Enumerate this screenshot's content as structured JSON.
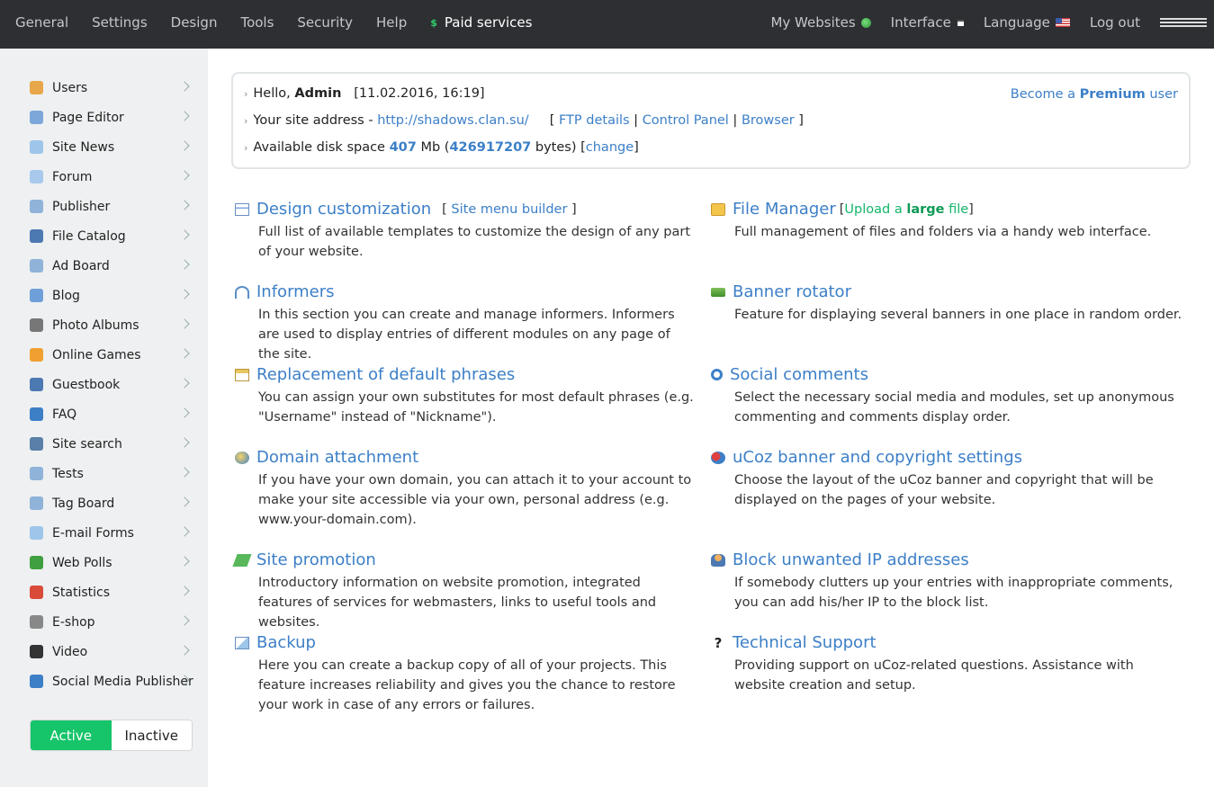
{
  "topnav": {
    "items": [
      "General",
      "Settings",
      "Design",
      "Tools",
      "Security",
      "Help"
    ],
    "paid_icon": "$",
    "paid": "Paid services",
    "right": {
      "my_websites": "My Websites",
      "interface": "Interface",
      "language": "Language",
      "logout": "Log out"
    }
  },
  "sidebar": {
    "items": [
      {
        "label": "Users",
        "icon": "user-icon",
        "color": "#e8a64a"
      },
      {
        "label": "Page Editor",
        "icon": "page-icon",
        "color": "#7da7d9"
      },
      {
        "label": "Site News",
        "icon": "bulb-icon",
        "color": "#9ec6ea"
      },
      {
        "label": "Forum",
        "icon": "chat-icon",
        "color": "#a8c9ec"
      },
      {
        "label": "Publisher",
        "icon": "book-icon",
        "color": "#8fb3d9"
      },
      {
        "label": "File Catalog",
        "icon": "disk-icon",
        "color": "#4d79b3"
      },
      {
        "label": "Ad Board",
        "icon": "board-icon",
        "color": "#8fb3d9"
      },
      {
        "label": "Blog",
        "icon": "blog-icon",
        "color": "#6f9fd8"
      },
      {
        "label": "Photo Albums",
        "icon": "camera-icon",
        "color": "#777777"
      },
      {
        "label": "Online Games",
        "icon": "game-icon",
        "color": "#f0a030"
      },
      {
        "label": "Guestbook",
        "icon": "guestbook-icon",
        "color": "#4d79b3"
      },
      {
        "label": "FAQ",
        "icon": "question-icon",
        "color": "#3c7fc7"
      },
      {
        "label": "Site search",
        "icon": "magnifier-icon",
        "color": "#5a7fa8"
      },
      {
        "label": "Tests",
        "icon": "test-icon",
        "color": "#8fb3d9"
      },
      {
        "label": "Tag Board",
        "icon": "tag-icon",
        "color": "#8fb3d9"
      },
      {
        "label": "E-mail Forms",
        "icon": "envelope-icon",
        "color": "#9ec6ea"
      },
      {
        "label": "Web Polls",
        "icon": "bar-chart-icon",
        "color": "#3fa040"
      },
      {
        "label": "Statistics",
        "icon": "pie-chart-icon",
        "color": "#d94a3a"
      },
      {
        "label": "E-shop",
        "icon": "cart-icon",
        "color": "#888888"
      },
      {
        "label": "Video",
        "icon": "clapper-icon",
        "color": "#333333"
      },
      {
        "label": "Social Media Publisher",
        "icon": "share-icon",
        "color": "#3c7fc7"
      }
    ],
    "toggle": {
      "active": "Active",
      "inactive": "Inactive"
    }
  },
  "info": {
    "hello_prefix": "Hello,",
    "username": "Admin",
    "datetime": "[11.02.2016, 16:19]",
    "premium_prefix": "Become a",
    "premium_word": "Premium",
    "premium_suffix": "user",
    "address_label": "Your site address -",
    "address": "http://shadows.clan.su/",
    "ftp": "FTP details",
    "cpanel": "Control Panel",
    "browser": "Browser",
    "disk_label": "Available disk space",
    "disk_mb": "407",
    "mb": "Mb (",
    "disk_bytes": "426917207",
    "bytes": "bytes) [",
    "change": "change",
    "close_bracket": "]"
  },
  "sections": {
    "design": {
      "title": "Design customization",
      "extra_link": "Site menu builder",
      "desc": "Full list of available templates to customize the design of any part of your website."
    },
    "filemanager": {
      "title": "File Manager",
      "upload_pre": "Upload a",
      "upload_bold": "large",
      "upload_post": "file",
      "desc": "Full management of files and folders via a handy web interface."
    },
    "informers": {
      "title": "Informers",
      "desc": "In this section you can create and manage informers. Informers are used to display entries of different modules on any page of the site."
    },
    "banner": {
      "title": "Banner rotator",
      "desc": "Feature for displaying several banners in one place in random order."
    },
    "phrases": {
      "title": "Replacement of default phrases",
      "desc": "You can assign your own substitutes for most default phrases (e.g. \"Username\" instead of \"Nickname\")."
    },
    "social": {
      "title": "Social comments",
      "desc": "Select the necessary social media and modules, set up anonymous commenting and comments display order."
    },
    "domain": {
      "title": "Domain attachment",
      "desc": "If you have your own domain, you can attach it to your account to make your site accessible via your own, personal address (e.g. www.your-domain.com)."
    },
    "ucoz": {
      "title": "uCoz banner and copyright settings",
      "desc": "Choose the layout of the uCoz banner and copyright that will be displayed on the pages of your website."
    },
    "promotion": {
      "title": "Site promotion",
      "desc": "Introductory information on website promotion, integrated features of services for webmasters, links to useful tools and websites."
    },
    "blockip": {
      "title": "Block unwanted IP addresses",
      "desc": "If somebody clutters up your entries with inappropriate comments, you can add his/her IP to the block list."
    },
    "backup": {
      "title": "Backup",
      "desc": "Here you can create a backup copy of all of your projects. This feature increases reliability and gives you the chance to restore your work in case of any errors or failures."
    },
    "support": {
      "title": "Technical Support",
      "icon": "?",
      "desc": "Providing support on uCoz-related questions. Assistance with website creation and setup."
    }
  }
}
